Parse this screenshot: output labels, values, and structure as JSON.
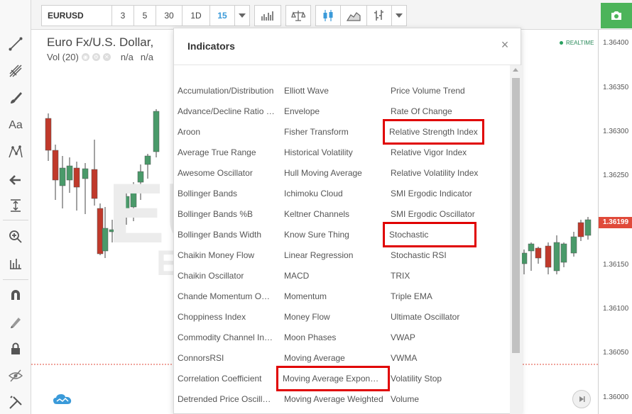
{
  "top_toolbar": {
    "symbol": "EURUSD",
    "intervals": [
      "3",
      "5",
      "30",
      "1D",
      "15"
    ],
    "active_interval": "15"
  },
  "chart": {
    "title": "Euro Fx/U.S. Dollar,",
    "volume_label": "Vol (20)",
    "volume_values": [
      "n/a",
      "n/a"
    ],
    "realtime_label": "REALTIME",
    "price_ticks": [
      "1.36400",
      "1.36350",
      "1.36300",
      "1.36250",
      "1.36200",
      "1.36150",
      "1.36100",
      "1.36050",
      "1.36000"
    ],
    "current_price": "1.36199",
    "colors": {
      "up": "#4a9a6a",
      "down": "#c0392b",
      "price_tag": "#e04a3a",
      "accent": "#3a9ad9"
    }
  },
  "modal": {
    "title": "Indicators",
    "close_label": "×",
    "columns": [
      [
        "Accumulation/Distribution",
        "Advance/Decline Ratio …",
        "Aroon",
        "Average True Range",
        "Awesome Oscillator",
        "Bollinger Bands",
        "Bollinger Bands %B",
        "Bollinger Bands Width",
        "Chaikin Money Flow",
        "Chaikin Oscillator",
        "Chande Momentum O…",
        "Choppiness Index",
        "Commodity Channel In…",
        "ConnorsRSI",
        "Correlation Coefficient",
        "Detrended Price Oscill…"
      ],
      [
        "Elliott Wave",
        "Envelope",
        "Fisher Transform",
        "Historical Volatility",
        "Hull Moving Average",
        "Ichimoku Cloud",
        "Keltner Channels",
        "Know Sure Thing",
        "Linear Regression",
        "MACD",
        "Momentum",
        "Money Flow",
        "Moon Phases",
        "Moving Average",
        "Moving Average Expon…",
        "Moving Average Weighted"
      ],
      [
        "Price Volume Trend",
        "Rate Of Change",
        "Relative Strength Index",
        "Relative Vigor Index",
        "Relative Volatility Index",
        "SMI Ergodic Indicator",
        "SMI Ergodic Oscillator",
        "Stochastic",
        "Stochastic RSI",
        "TRIX",
        "Triple EMA",
        "Ultimate Oscillator",
        "VWAP",
        "VWMA",
        "Volatility Stop",
        "Volume"
      ]
    ],
    "highlighted": [
      "Relative Strength Index",
      "Stochastic",
      "Moving Average Expon…"
    ],
    "highlight_color": "#e00000"
  }
}
